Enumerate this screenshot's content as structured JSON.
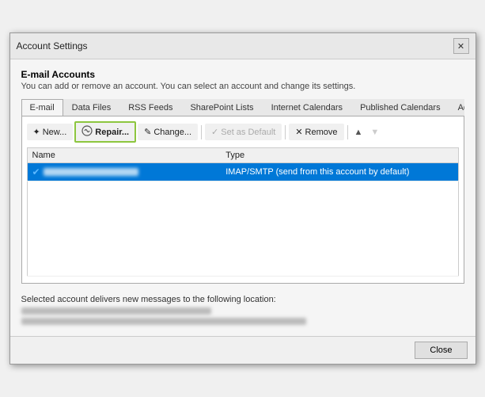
{
  "window": {
    "title": "Account Settings",
    "close_label": "✕"
  },
  "header": {
    "section_title": "E-mail Accounts",
    "section_desc": "You can add or remove an account. You can select an account and change its settings."
  },
  "tabs": [
    {
      "id": "email",
      "label": "E-mail",
      "active": true
    },
    {
      "id": "datafiles",
      "label": "Data Files",
      "active": false
    },
    {
      "id": "rssfeeds",
      "label": "RSS Feeds",
      "active": false
    },
    {
      "id": "sharepointlists",
      "label": "SharePoint Lists",
      "active": false
    },
    {
      "id": "internetcalendars",
      "label": "Internet Calendars",
      "active": false
    },
    {
      "id": "publishedcalendars",
      "label": "Published Calendars",
      "active": false
    },
    {
      "id": "addressbooks",
      "label": "Address Books",
      "active": false
    }
  ],
  "toolbar": {
    "new_label": "New...",
    "repair_label": "Repair...",
    "change_label": "Change...",
    "setdefault_label": "Set as Default",
    "remove_label": "Remove",
    "up_label": "▲",
    "down_label": "▼"
  },
  "table": {
    "col_name": "Name",
    "col_type": "Type",
    "rows": [
      {
        "name": "████████████",
        "type": "IMAP/SMTP (send from this account by default)",
        "selected": true,
        "default": true
      }
    ]
  },
  "deliver_section": {
    "label": "Selected account delivers new messages to the following location:",
    "location_line1": "███████████████████",
    "location_line2": "████████████████████████████████████████████"
  },
  "footer": {
    "close_label": "Close"
  }
}
